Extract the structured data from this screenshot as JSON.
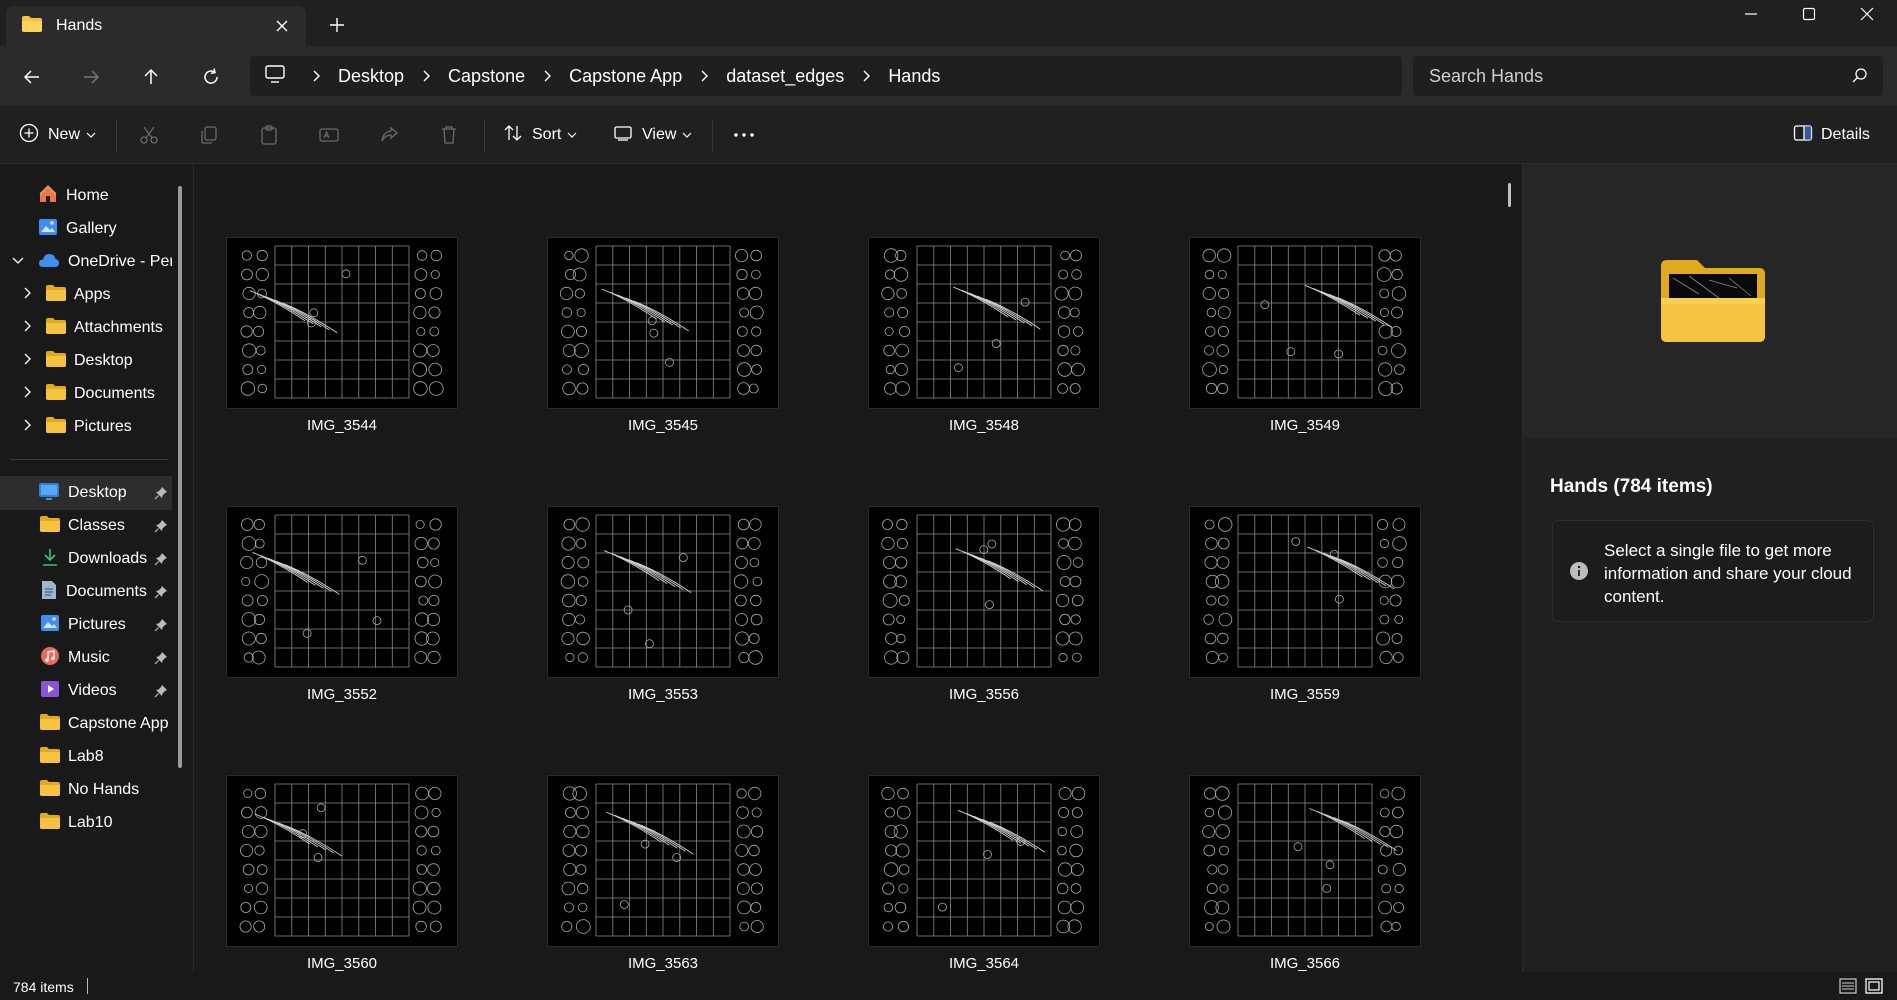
{
  "window": {
    "tab_title": "Hands"
  },
  "address": {
    "breadcrumbs": [
      "Desktop",
      "Capstone",
      "Capstone App",
      "dataset_edges",
      "Hands"
    ],
    "search_placeholder": "Search Hands"
  },
  "toolbar": {
    "new_label": "New",
    "sort_label": "Sort",
    "view_label": "View",
    "details_label": "Details"
  },
  "sidebar": {
    "top": [
      {
        "label": "Home",
        "icon": "home-icon"
      },
      {
        "label": "Gallery",
        "icon": "gallery-icon"
      },
      {
        "label": "OneDrive - Perso",
        "icon": "cloud-icon"
      }
    ],
    "onedrive_children": [
      "Apps",
      "Attachments",
      "Desktop",
      "Documents",
      "Pictures"
    ],
    "quick_access": [
      {
        "label": "Desktop",
        "icon": "desktop-icon",
        "pinned": true
      },
      {
        "label": "Classes",
        "icon": "folder-icon",
        "pinned": true
      },
      {
        "label": "Downloads",
        "icon": "download-icon",
        "pinned": true
      },
      {
        "label": "Documents",
        "icon": "document-icon",
        "pinned": true
      },
      {
        "label": "Pictures",
        "icon": "pictures-icon",
        "pinned": true
      },
      {
        "label": "Music",
        "icon": "music-icon",
        "pinned": true
      },
      {
        "label": "Videos",
        "icon": "videos-icon",
        "pinned": true
      },
      {
        "label": "Capstone App",
        "icon": "folder-icon",
        "pinned": false
      },
      {
        "label": "Lab8",
        "icon": "folder-icon",
        "pinned": false
      },
      {
        "label": "No Hands",
        "icon": "folder-icon",
        "pinned": false
      },
      {
        "label": "Lab10",
        "icon": "folder-icon",
        "pinned": false
      }
    ]
  },
  "files": [
    "IMG_3544",
    "IMG_3545",
    "IMG_3548",
    "IMG_3549",
    "IMG_3552",
    "IMG_3553",
    "IMG_3556",
    "IMG_3559",
    "IMG_3560",
    "IMG_3563",
    "IMG_3564",
    "IMG_3566"
  ],
  "details": {
    "title": "Hands (784 items)",
    "info": "Select a single file to get more information and share your cloud content."
  },
  "status": {
    "count": "784 items"
  },
  "colors": {
    "folder": "#f5c242",
    "folder_dark": "#e0a91e",
    "accent_blue": "#3f8ef0",
    "background": "#191919"
  }
}
